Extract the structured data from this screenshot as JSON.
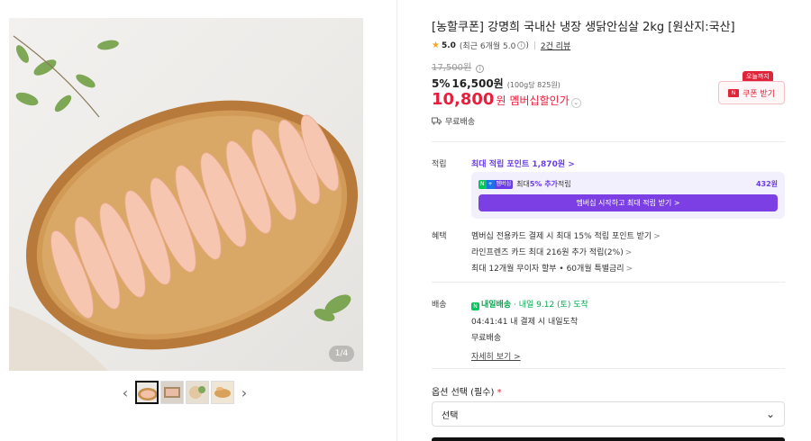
{
  "gallery": {
    "counter": "1/4",
    "prev": "‹",
    "next": "›",
    "thumb_count": 4
  },
  "product": {
    "title": "[농할쿠폰] 강명희 국내산 냉장 생닭안심살 2kg [원산지:국산]",
    "rating_star": "★",
    "rating": "5.0",
    "rating_period": "(최근 6개월 5.0",
    "rating_info": "i",
    "rating_close": ")",
    "reviews": "2건 리뷰",
    "original_price": "17,500원",
    "discount_pct": "5%",
    "sale_price": "16,500원",
    "unit_price": "(100g당 825원)",
    "member_price": "10,800",
    "member_won": "원",
    "member_label": "멤버십할인가",
    "coupon_badge": "오늘까지",
    "coupon_icon": "N",
    "coupon_button": "쿠폰 받기",
    "shipping": "무료배송"
  },
  "points": {
    "label": "적립",
    "title": "최대 적립 포인트 1,870원 >",
    "badge_n": "N",
    "badge_plus": "+",
    "badge_member": "멤버십",
    "extra_text_prefix": "최대 ",
    "extra_text_emph": "5% 추가",
    "extra_text_suffix": " 적립",
    "extra_points": "432원",
    "member_cta": "멤버십 시작하고 최대 적립 받기 >"
  },
  "benefits": {
    "label": "혜택",
    "lines": [
      "멤버십 전용카드 결제 시 최대 15% 적립 포인트 받기",
      "라인프렌즈 카드 최대 216원 추가 적립(2%)",
      "최대 12개월 무이자 할부 • 60개월 특별금리"
    ],
    "arrow": ">"
  },
  "delivery": {
    "label": "배송",
    "tomorrow_icon": "N",
    "tomorrow": "내일배송",
    "date": " · 내일 9.12 (토) 도착",
    "cutoff": "04:41:41  내 결제 시 내일도착",
    "fee": "무료배송",
    "detail": "자세히 보기 >"
  },
  "option": {
    "label": "옵션 선택 (필수)",
    "required_mark": "*",
    "select_value": "선택",
    "chevron": "⌄"
  }
}
